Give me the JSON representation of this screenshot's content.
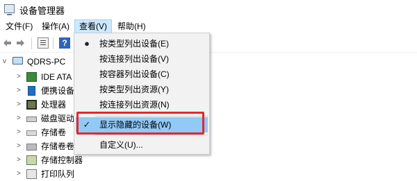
{
  "window": {
    "title": "设备管理器"
  },
  "menubar": {
    "items": [
      {
        "label": "文件(F)"
      },
      {
        "label": "操作(A)"
      },
      {
        "label": "查看(V)"
      },
      {
        "label": "帮助(H)"
      }
    ]
  },
  "toolbar": {
    "help_glyph": "?"
  },
  "tree": {
    "root": {
      "label": "QDRS-PC",
      "expander": "v"
    },
    "items": [
      {
        "label": "IDE ATA",
        "expander": ">"
      },
      {
        "label": "便携设备",
        "expander": ">"
      },
      {
        "label": "处理器",
        "expander": ">"
      },
      {
        "label": "磁盘驱动",
        "expander": ">"
      },
      {
        "label": "存储卷",
        "expander": ">"
      },
      {
        "label": "存储卷卷",
        "expander": ">"
      },
      {
        "label": "存储控制器",
        "expander": ">"
      },
      {
        "label": "打印队列",
        "expander": ">"
      }
    ]
  },
  "view_menu": {
    "items": [
      {
        "label": "按类型列出设备(E)",
        "mark": "●"
      },
      {
        "label": "按连接列出设备(V)",
        "mark": ""
      },
      {
        "label": "按容器列出设备(C)",
        "mark": ""
      },
      {
        "label": "按类型列出资源(Y)",
        "mark": ""
      },
      {
        "label": "按连接列出资源(N)",
        "mark": ""
      },
      {
        "label": "显示隐藏的设备(W)",
        "mark": "✓"
      },
      {
        "label": "自定义(U)...",
        "mark": ""
      }
    ]
  },
  "colors": {
    "menu_active_bg": "#cce8ff",
    "checked_item_bg": "#91c9f7",
    "annotation_red": "#e8252a"
  }
}
